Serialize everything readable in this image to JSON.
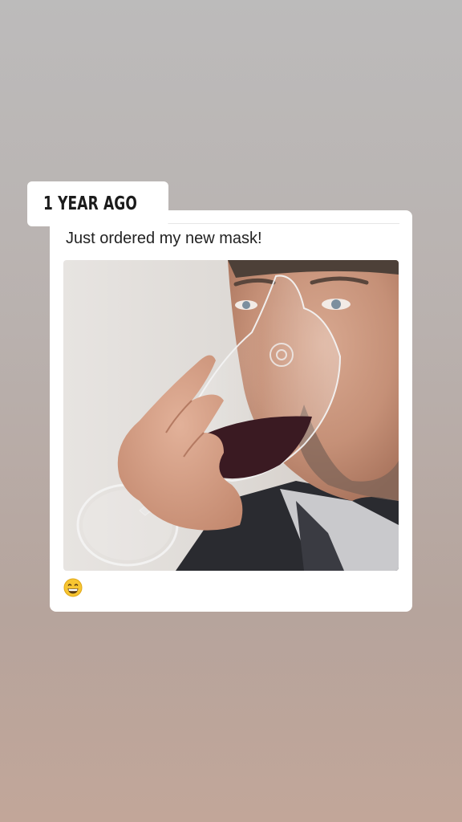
{
  "memory_badge": {
    "icon": "history-clock-icon",
    "label": "1 YEAR AGO"
  },
  "post": {
    "caption": "Just ordered my new mask!",
    "image_alt": "man drinking red wine from a wine glass shaped like a face mask",
    "reaction_emoji": "grinning-face-icon"
  },
  "colors": {
    "background_top": "#bcbbbb",
    "background_bottom": "#c2a699",
    "card": "#ffffff",
    "text": "#222222"
  }
}
